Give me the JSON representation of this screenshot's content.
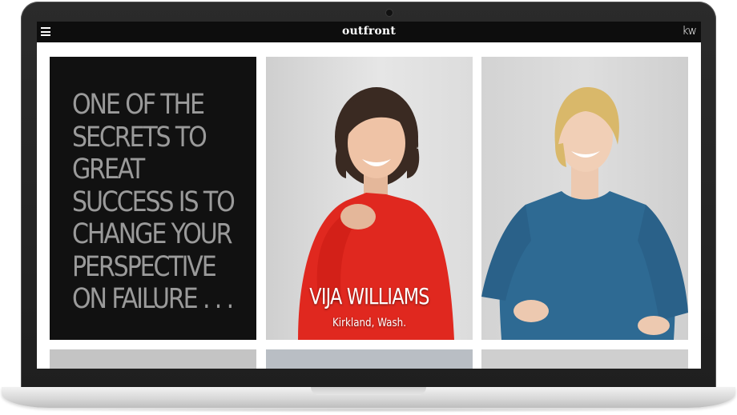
{
  "navbar": {
    "menu_icon": "hamburger-menu-icon",
    "brand": "outfront",
    "right_logo": "kw"
  },
  "quote": {
    "lines": [
      "ONE OF THE",
      "SECRETS TO",
      "GREAT",
      "SUCCESS IS TO",
      "CHANGE YOUR",
      "PERSPECTIVE",
      "ON FAILURE . . ."
    ]
  },
  "profiles": [
    {
      "name": "VIJA WILLIAMS",
      "location": "Kirkland, Wash.",
      "dress_color": "#e0281f"
    },
    {
      "name": "",
      "location": "",
      "dress_color": "#2e6a93"
    }
  ],
  "colors": {
    "navbar": "#0d0d0d",
    "quote_bg": "#111111",
    "quote_text": "#9a9a9a"
  }
}
